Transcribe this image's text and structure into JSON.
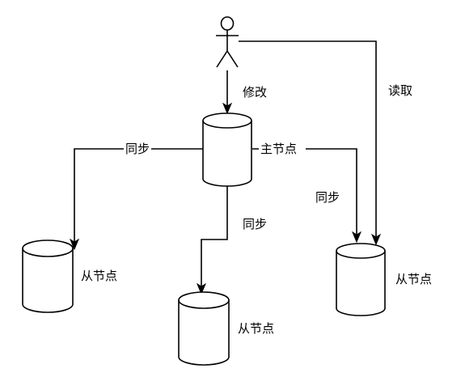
{
  "labels": {
    "edit": "修改",
    "read": "读取",
    "master": "主节点",
    "sync_left": "同步",
    "sync_middle": "同步",
    "sync_right": "同步",
    "slave_left": "从节点",
    "slave_middle": "从节点",
    "slave_right": "从节点"
  },
  "colors": {
    "line": "#000000",
    "fill": "#ffffff"
  }
}
